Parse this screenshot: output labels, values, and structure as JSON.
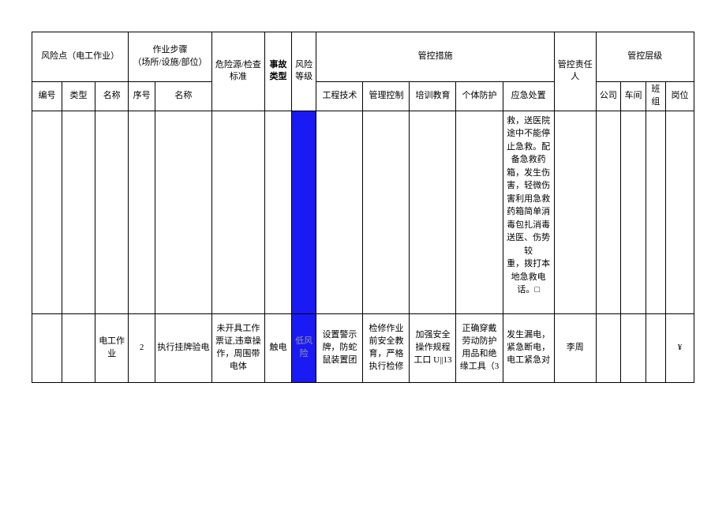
{
  "header_top": {
    "risk_point": "风险点（电工作业）",
    "work_steps": "作业步骤\n（场所/设施/部位）",
    "hazard_source": "危险源/检查标准",
    "accident_type": "事故类型",
    "risk_level": "风险等级",
    "control_measures": "管控措施",
    "control_responsible": "管控责任人",
    "control_level": "管控层级"
  },
  "header_sub": {
    "seq": "编号",
    "type": "类型",
    "name": "名称",
    "step_seq": "序号",
    "step_name": "名称",
    "eng_tech": "工程技术",
    "mgmt_control": "管理控制",
    "training": "培训教育",
    "ppe": "个体防护",
    "emergency": "应急处置",
    "company": "公司",
    "workshop": "车间",
    "team": "班组",
    "post": "岗位"
  },
  "row1": {
    "emergency": "救，送医院途中不能停止急救。配备急救药箱，发生伤害，轻微伤害利用急救药箱简单消毒包扎消毒送医、伤势较\n重，拨打本地急救电话。□"
  },
  "row2": {
    "name": "电工作业",
    "step_seq": "2",
    "step_name": "执行挂牌验电",
    "hazard_source": "未开具工作票证,违章操作，周围带电体",
    "accident_type": "触电",
    "risk_level": "低风险",
    "eng_tech": "设置警示牌，防蛇鼠装置团",
    "mgmt_control": "检修作业前安全教育，严格执行检修",
    "training": "加强安全操作规程\n工口 U||13",
    "ppe": "正确穿戴劳动防护用品和绝缘工具（3",
    "emergency": "发生漏电，紧急断电，电工紧急对",
    "responsible": "李周",
    "post": "¥"
  }
}
